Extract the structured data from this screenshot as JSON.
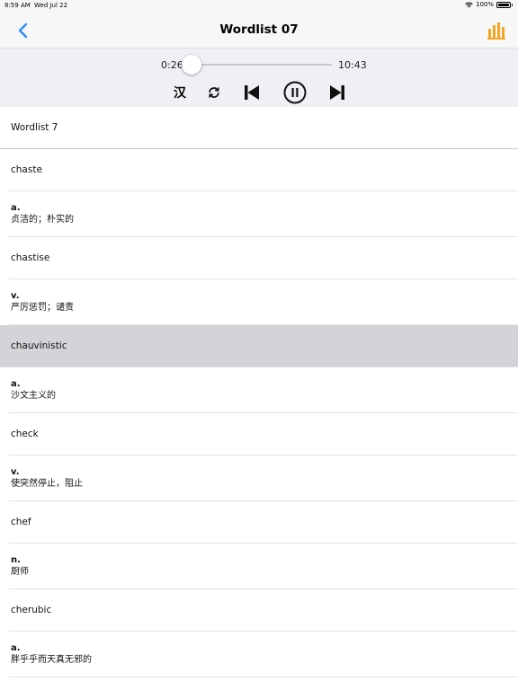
{
  "status_bar": {
    "time": "8:59 AM",
    "date": "Wed Jul 22",
    "battery": "100%",
    "battery_level": 1.0
  },
  "nav": {
    "title": "Wordlist 07",
    "back_icon": "chevron-left-icon",
    "stats_icon": "bar-chart-icon",
    "accent_color": "#2f8cff",
    "stats_color": "#f5a623"
  },
  "player": {
    "elapsed": "0:26",
    "total": "10:43",
    "progress": 0.04,
    "han_label": "汉",
    "icons": [
      "repeat-icon",
      "skip-previous-icon",
      "pause-icon",
      "skip-next-icon"
    ]
  },
  "list": {
    "header": "Wordlist 7",
    "entries": [
      {
        "word": "chaste",
        "pos": "a.",
        "meaning": "贞洁的；朴实的",
        "selected": false
      },
      {
        "word": "chastise",
        "pos": "v.",
        "meaning": "严厉惩罚；谴责",
        "selected": false
      },
      {
        "word": "chauvinistic",
        "pos": "a.",
        "meaning": "沙文主义的",
        "selected": true
      },
      {
        "word": "check",
        "pos": "v.",
        "meaning": "使突然停止，阻止",
        "selected": false
      },
      {
        "word": "chef",
        "pos": "n.",
        "meaning": "厨师",
        "selected": false
      },
      {
        "word": "cherubic",
        "pos": "a.",
        "meaning": "胖乎乎而天真无邪的",
        "selected": false
      }
    ]
  }
}
